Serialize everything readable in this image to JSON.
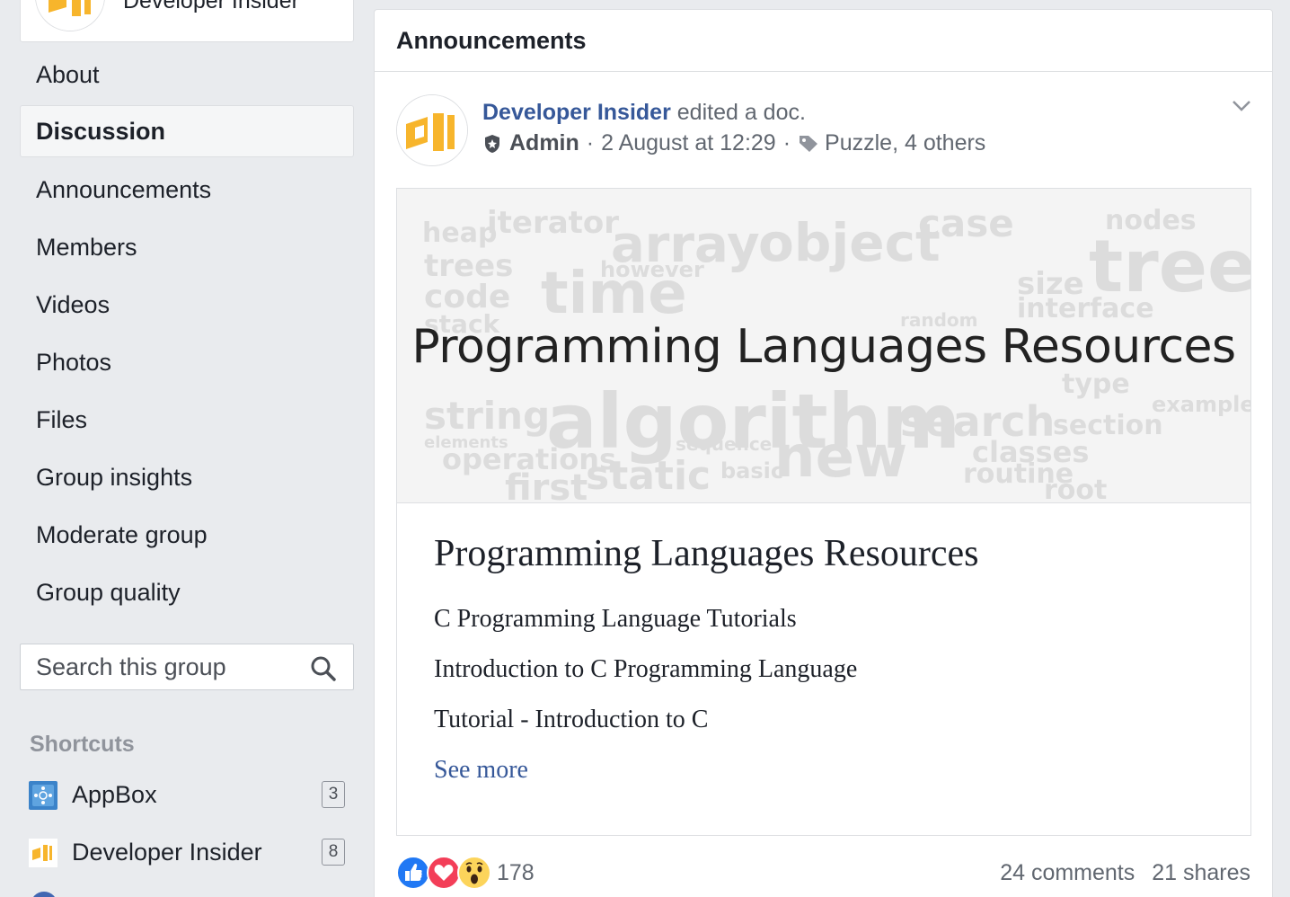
{
  "group": {
    "name": "Developer Insider"
  },
  "nav": {
    "items": [
      {
        "label": "About"
      },
      {
        "label": "Discussion",
        "active": true
      },
      {
        "label": "Announcements"
      },
      {
        "label": "Members"
      },
      {
        "label": "Videos"
      },
      {
        "label": "Photos"
      },
      {
        "label": "Files"
      },
      {
        "label": "Group insights"
      },
      {
        "label": "Moderate group"
      },
      {
        "label": "Group quality"
      }
    ]
  },
  "search": {
    "placeholder": "Search this group"
  },
  "shortcuts": {
    "title": "Shortcuts",
    "items": [
      {
        "label": "AppBox",
        "count": "3",
        "icon": "appbox-icon"
      },
      {
        "label": "Developer Insider",
        "count": "8",
        "icon": "developer-insider-logo"
      }
    ]
  },
  "main": {
    "header": "Announcements",
    "post": {
      "author": "Developer Insider",
      "action": "edited a doc.",
      "role": "Admin",
      "separator": "·",
      "date": "2 August at 12:29",
      "tags": "Puzzle, 4 others",
      "doc": {
        "banner_title": "Programming Languages Resources",
        "title": "Programming Languages Resources",
        "lines": [
          "C Programming Language Tutorials",
          "Introduction to C Programming Language",
          "Tutorial - Introduction to C"
        ],
        "see_more": "See more"
      },
      "reactions": {
        "count": "178",
        "types": [
          "like-icon",
          "love-icon",
          "wow-icon"
        ]
      },
      "comments": "24 comments",
      "shares": "21 shares"
    }
  },
  "colors": {
    "link": "#365899",
    "background": "#e9ebee",
    "logo_yellow": "#f7b52c",
    "like_blue": "#2078f4",
    "love_red": "#f33e58",
    "wow_yellow": "#fcd45b"
  }
}
